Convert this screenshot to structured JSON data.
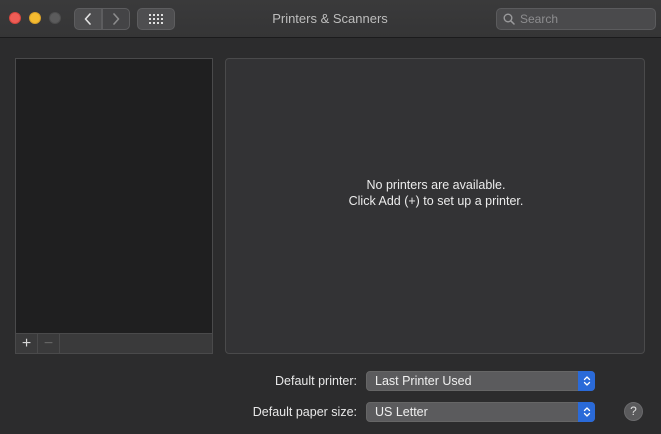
{
  "window": {
    "title": "Printers & Scanners"
  },
  "toolbar": {
    "back_icon": "chevron-left-icon",
    "forward_icon": "chevron-right-icon",
    "show_all_icon": "grid-icon"
  },
  "search": {
    "placeholder": "Search",
    "icon": "search-icon"
  },
  "printer_list": {
    "items": [],
    "add_label": "+",
    "remove_label": "−"
  },
  "detail": {
    "line1": "No printers are available.",
    "line2": "Click Add (+) to set up a printer."
  },
  "defaults": {
    "printer_label": "Default printer:",
    "printer_value": "Last Printer Used",
    "paper_label": "Default paper size:",
    "paper_value": "US Letter"
  },
  "help": {
    "label": "?"
  },
  "colors": {
    "close": "#ee5d56",
    "minimize": "#f5bb30",
    "popup_accent": "#2a6ad8"
  }
}
